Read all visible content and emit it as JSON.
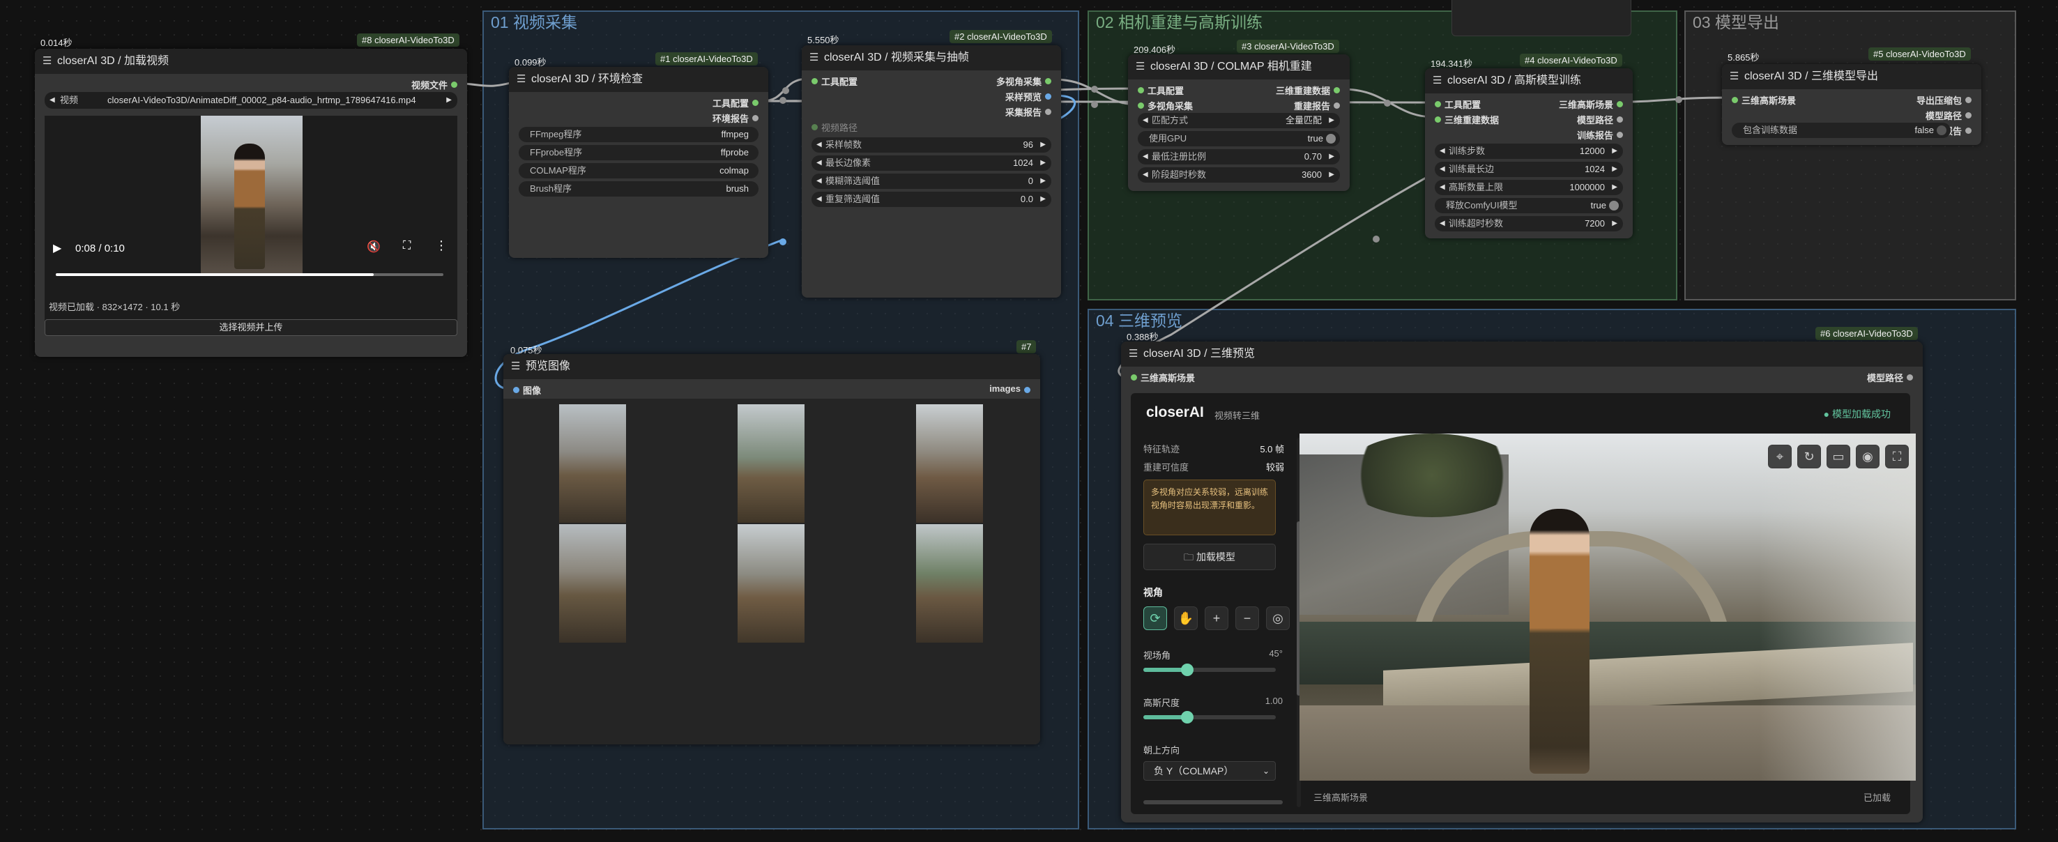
{
  "groups": {
    "g1": "01 视频采集",
    "g2": "02 相机重建与高斯训练",
    "g3": "03 模型导出",
    "g4": "04 三维预览"
  },
  "colors": {
    "accent": "#5ebc9c",
    "port_green": "#7acb6c",
    "port_blue": "#6aa9e6",
    "group_blue": "#1e2e3d",
    "group_green": "#1f2f23"
  },
  "node8": {
    "time": "0.014秒",
    "badge": "#8 closerAI-VideoTo3D",
    "title": "closerAI 3D / 加载视频",
    "out_video": "视频文件",
    "combo_label": "视频",
    "combo_value": "closerAI-VideoTo3D/AnimateDiff_00002_p84-audio_hrtmp_1789647416.mp4",
    "play_time": "0:08 / 0:10",
    "progress": 0.82,
    "status": "视频已加载 · 832×1472 · 10.1 秒",
    "upload_button": "选择视频并上传"
  },
  "node1": {
    "time": "0.099秒",
    "badge": "#1 closerAI-VideoTo3D",
    "title": "closerAI 3D / 环境检查",
    "out1": "工具配置",
    "out2": "环境报告",
    "rows": [
      {
        "label": "FFmpeg程序",
        "value": "ffmpeg"
      },
      {
        "label": "FFprobe程序",
        "value": "ffprobe"
      },
      {
        "label": "COLMAP程序",
        "value": "colmap"
      },
      {
        "label": "Brush程序",
        "value": "brush"
      }
    ]
  },
  "node2": {
    "time": "5.550秒",
    "badge": "#2 closerAI-VideoTo3D",
    "title": "closerAI 3D / 视频采集与抽帧",
    "in1": "工具配置",
    "in2": "视频路径",
    "out1": "多视角采集",
    "out2": "采样预览",
    "out3": "采集报告",
    "rows": [
      {
        "label": "采样帧数",
        "value": "96"
      },
      {
        "label": "最长边像素",
        "value": "1024"
      },
      {
        "label": "模糊筛选阈值",
        "value": "0"
      },
      {
        "label": "重复筛选阈值",
        "value": "0.0"
      }
    ]
  },
  "node7": {
    "time": "0.075秒",
    "badge": "#7",
    "title": "预览图像",
    "in1": "图像",
    "out1": "images"
  },
  "node3": {
    "time": "209.406秒",
    "badge": "#3 closerAI-VideoTo3D",
    "title": "closerAI 3D / COLMAP 相机重建",
    "in1": "工具配置",
    "in2": "多视角采集",
    "out1": "三维重建数据",
    "out2": "重建报告",
    "rows": [
      {
        "label": "匹配方式",
        "value": "全量匹配"
      },
      {
        "label": "使用GPU",
        "value": "true"
      },
      {
        "label": "最低注册比例",
        "value": "0.70"
      },
      {
        "label": "阶段超时秒数",
        "value": "3600"
      }
    ]
  },
  "node4": {
    "time": "194.341秒",
    "badge": "#4 closerAI-VideoTo3D",
    "title": "closerAI 3D / 高斯模型训练",
    "in1": "工具配置",
    "in2": "三维重建数据",
    "out1": "三维高斯场景",
    "out2": "模型路径",
    "out3": "训练报告",
    "rows": [
      {
        "label": "训练步数",
        "value": "12000"
      },
      {
        "label": "训练最长边",
        "value": "1024"
      },
      {
        "label": "高斯数量上限",
        "value": "1000000"
      },
      {
        "label": "释放ComfyUI模型",
        "value": "true"
      },
      {
        "label": "训练超时秒数",
        "value": "7200"
      }
    ]
  },
  "node5": {
    "time": "5.865秒",
    "badge": "#5 closerAI-VideoTo3D",
    "title": "closerAI 3D / 三维模型导出",
    "in1": "三维高斯场景",
    "out1": "导出压缩包",
    "out2": "模型路径",
    "out3": "训练报告",
    "row_label": "包含训练数据",
    "row_value": "false"
  },
  "node6": {
    "time": "0.388秒",
    "badge": "#6 closerAI-VideoTo3D",
    "title": "closerAI 3D / 三维预览",
    "in1": "三维高斯场景",
    "out1": "模型路径",
    "brand": "closerAI",
    "subtitle": "视频转三维",
    "status": "● 模型加载成功",
    "info1_label": "特征轨迹",
    "info1_value": "5.0 帧",
    "info2_label": "重建可信度",
    "info2_value": "较弱",
    "warning": "多视角对应关系较弱，远离训练视角时容易出现漂浮和重影。",
    "load_button": "加载模型",
    "view_label": "视角",
    "fov_label": "视场角",
    "fov_value": "45°",
    "fov_level": 0.33,
    "gauss_label": "高斯尺度",
    "gauss_value": "1.00",
    "gauss_level": 0.33,
    "up_label": "朝上方向",
    "up_value": "负 Y（COLMAP）",
    "footer_left": "三维高斯场景",
    "footer_right": "已加载"
  }
}
